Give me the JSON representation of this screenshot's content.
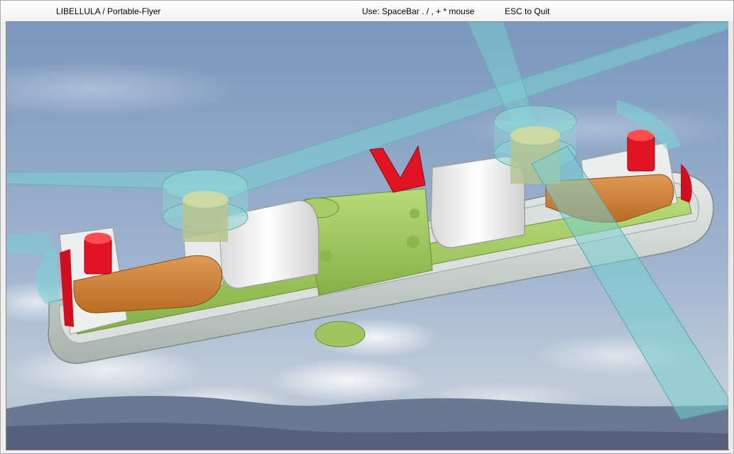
{
  "window": {
    "title": "LIBELLULA  /  Portable-Flyer",
    "controls_hint": "Use: SpaceBar . / , + *  mouse",
    "quit_hint": "ESC to Quit"
  },
  "scene": {
    "subject": "portable flyer 3D model",
    "background": "sky with clouds and mountains",
    "colors": {
      "sky_top": "#7d98bd",
      "sky_bottom": "#b9c7d8",
      "mountain": "#5e6c86",
      "hull": "#c9d2ce",
      "frame": "#9dc95a",
      "motor_housing": "#f1f2f1",
      "arm": "#d8893a",
      "rotor": "#79cfd0",
      "red_part": "#dd1020"
    }
  }
}
